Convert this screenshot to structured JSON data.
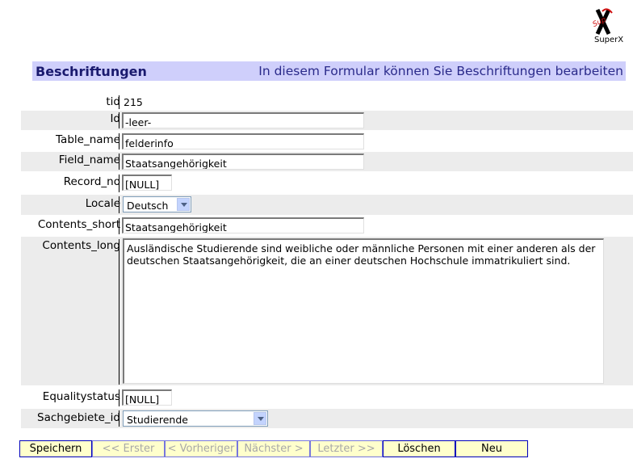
{
  "logo": {
    "text": "SuperX"
  },
  "header": {
    "title": "Beschriftungen",
    "subtitle": "In diesem Formular können Sie Beschriftungen bearbeiten"
  },
  "form": {
    "tid": {
      "label": "tid",
      "value": "215"
    },
    "id": {
      "label": "Id",
      "value": "-leer-"
    },
    "table_name": {
      "label": "Table_name",
      "value": "felderinfo"
    },
    "field_name": {
      "label": "Field_name",
      "value": "Staatsangehörigkeit"
    },
    "record_no": {
      "label": "Record_no",
      "value": "[NULL]"
    },
    "locale": {
      "label": "Locale",
      "value": "Deutsch"
    },
    "contents_short": {
      "label": "Contents_short",
      "value": "Staatsangehörigkeit"
    },
    "contents_long": {
      "label": "Contents_long",
      "value": "Ausländische Studierende sind weibliche oder männliche Personen mit einer anderen als der deutschen Staatsangehörigkeit, die an einer deutschen Hochschule immatrikuliert sind."
    },
    "equalitystatus": {
      "label": "Equalitystatus",
      "value": "[NULL]"
    },
    "sachgebiete_id": {
      "label": "Sachgebiete_id",
      "value": "Studierende"
    }
  },
  "buttons": {
    "save": "Speichern",
    "first": "<< Erster",
    "previous": "< Vorheriger",
    "next": "Nächster >",
    "last": "Letzter >>",
    "delete": "Löschen",
    "new": "Neu"
  },
  "colors": {
    "header_bg": "#cfcffb",
    "header_text": "#1a1a6e",
    "row_shade": "#ececec",
    "button_bg": "#ffffcc",
    "button_border": "#0000bb"
  }
}
